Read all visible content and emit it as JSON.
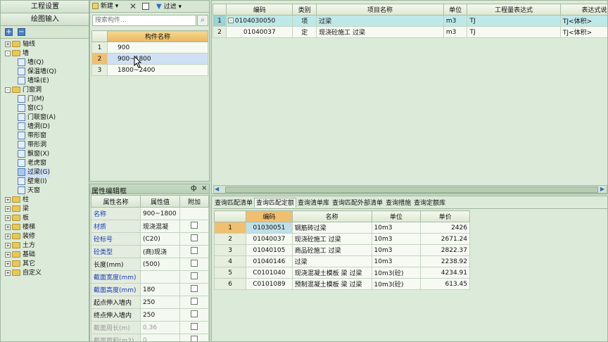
{
  "nav": {
    "project_settings": "工程设置",
    "drawing_input": "绘图输入"
  },
  "tree": [
    {
      "label": "轴线",
      "level": 0,
      "type": "folder",
      "exp": "+"
    },
    {
      "label": "墙",
      "level": 0,
      "type": "folder",
      "exp": "-"
    },
    {
      "label": "墙(Q)",
      "level": 1,
      "type": "item",
      "icon": "wall-icon"
    },
    {
      "label": "保温墙(Q)",
      "level": 1,
      "type": "item",
      "icon": "insulation-wall-icon"
    },
    {
      "label": "墙垛(E)",
      "level": 1,
      "type": "item",
      "icon": "pilaster-icon"
    },
    {
      "label": "门窗洞",
      "level": 0,
      "type": "folder",
      "exp": "-"
    },
    {
      "label": "门(M)",
      "level": 1,
      "type": "item",
      "icon": "door-icon"
    },
    {
      "label": "窗(C)",
      "level": 1,
      "type": "item",
      "icon": "window-icon"
    },
    {
      "label": "门联窗(A)",
      "level": 1,
      "type": "item",
      "icon": "door-window-icon"
    },
    {
      "label": "墙洞(D)",
      "level": 1,
      "type": "item",
      "icon": "wall-opening-icon"
    },
    {
      "label": "带形窗",
      "level": 1,
      "type": "item",
      "icon": "strip-window-icon"
    },
    {
      "label": "带形洞",
      "level": 1,
      "type": "item",
      "icon": "strip-opening-icon"
    },
    {
      "label": "飘窗(X)",
      "level": 1,
      "type": "item",
      "icon": "bay-window-icon"
    },
    {
      "label": "老虎窗",
      "level": 1,
      "type": "item",
      "icon": "dormer-icon"
    },
    {
      "label": "过梁(G)",
      "level": 1,
      "type": "item",
      "icon": "lintel-icon",
      "selected": true
    },
    {
      "label": "壁龛(I)",
      "level": 1,
      "type": "item",
      "icon": "niche-icon"
    },
    {
      "label": "天窗",
      "level": 1,
      "type": "item",
      "icon": "skylight-icon"
    },
    {
      "label": "柱",
      "level": 0,
      "type": "folder",
      "exp": "+"
    },
    {
      "label": "梁",
      "level": 0,
      "type": "folder",
      "exp": "+"
    },
    {
      "label": "板",
      "level": 0,
      "type": "folder",
      "exp": "+"
    },
    {
      "label": "楼梯",
      "level": 0,
      "type": "folder",
      "exp": "+"
    },
    {
      "label": "装修",
      "level": 0,
      "type": "folder",
      "exp": "+"
    },
    {
      "label": "土方",
      "level": 0,
      "type": "folder",
      "exp": "+"
    },
    {
      "label": "基础",
      "level": 0,
      "type": "folder",
      "exp": "+"
    },
    {
      "label": "其它",
      "level": 0,
      "type": "folder",
      "exp": "+"
    },
    {
      "label": "自定义",
      "level": 0,
      "type": "folder",
      "exp": "+"
    }
  ],
  "toolbar": {
    "new_label": "新建",
    "filter_label": "过滤"
  },
  "search": {
    "placeholder": "搜索构件..."
  },
  "components": {
    "header": "构件名称",
    "rows": [
      {
        "n": "1",
        "name": "900"
      },
      {
        "n": "2",
        "name": "900~1800"
      },
      {
        "n": "3",
        "name": "1800~2400"
      }
    ]
  },
  "props": {
    "title": "属性编辑框",
    "pin": "ф",
    "close": "×",
    "headers": [
      "属性名称",
      "属性值",
      "附加"
    ],
    "rows": [
      {
        "name": "名称",
        "value": "900~1800",
        "style": "blue",
        "cb": false
      },
      {
        "name": "材质",
        "value": "现浇混凝",
        "style": "blue",
        "cb": true
      },
      {
        "name": "砼标号",
        "value": "(C20)",
        "style": "blue",
        "cb": true
      },
      {
        "name": "砼类型",
        "value": "(商)现浇",
        "style": "blue",
        "cb": true
      },
      {
        "name": "长度(mm)",
        "value": "(500)",
        "style": "",
        "cb": true
      },
      {
        "name": "截面宽度(mm)",
        "value": "",
        "style": "blue",
        "cb": true
      },
      {
        "name": "截面高度(mm)",
        "value": "180",
        "style": "blue",
        "cb": true
      },
      {
        "name": "起点伸入墙内",
        "value": "250",
        "style": "",
        "cb": true
      },
      {
        "name": "终点伸入墙内",
        "value": "250",
        "style": "",
        "cb": true
      },
      {
        "name": "截面周长(m)",
        "value": "0.36",
        "style": "gray",
        "cb": true
      },
      {
        "name": "截面面积(m2)",
        "value": "0",
        "style": "gray",
        "cb": true
      }
    ]
  },
  "quant": {
    "headers": [
      "编码",
      "类别",
      "项目名称",
      "单位",
      "工程量表达式",
      "表达式说明"
    ],
    "rows": [
      {
        "n": "1",
        "code": "0104030050",
        "cat": "项",
        "name": "过梁",
        "unit": "m3",
        "expr": "TJ",
        "desc": "TJ<体积>",
        "hl": true,
        "exp": "-"
      },
      {
        "n": "2",
        "code": "01040037",
        "cat": "定",
        "name": "现浇砼施工 过梁",
        "unit": "m3",
        "expr": "TJ",
        "desc": "TJ<体积>",
        "hl": false,
        "exp": ""
      }
    ]
  },
  "query_tabs": [
    "查询匹配清单",
    "查询匹配定额",
    "查询清单库",
    "查询匹配外部清单",
    "查询措施",
    "查询定额库"
  ],
  "query": {
    "headers": [
      "编码",
      "名称",
      "单位",
      "单价"
    ],
    "rows": [
      {
        "n": "1",
        "code": "01030051",
        "name": "钢筋砖过梁",
        "unit": "10m3",
        "price": "2426"
      },
      {
        "n": "2",
        "code": "01040037",
        "name": "现浇砼施工 过梁",
        "unit": "10m3",
        "price": "2671.24"
      },
      {
        "n": "3",
        "code": "01040105",
        "name": "商品砼施工 过梁",
        "unit": "10m3",
        "price": "2822.37"
      },
      {
        "n": "4",
        "code": "01040146",
        "name": "过梁",
        "unit": "10m3",
        "price": "2238.92"
      },
      {
        "n": "5",
        "code": "C0101040",
        "name": "现浇混凝土模板 梁 过梁",
        "unit": "10m3(砼)",
        "price": "4234.91"
      },
      {
        "n": "6",
        "code": "C0101089",
        "name": "预制混凝土模板 梁 过梁",
        "unit": "10m3(砼)",
        "price": "613.45"
      }
    ]
  }
}
